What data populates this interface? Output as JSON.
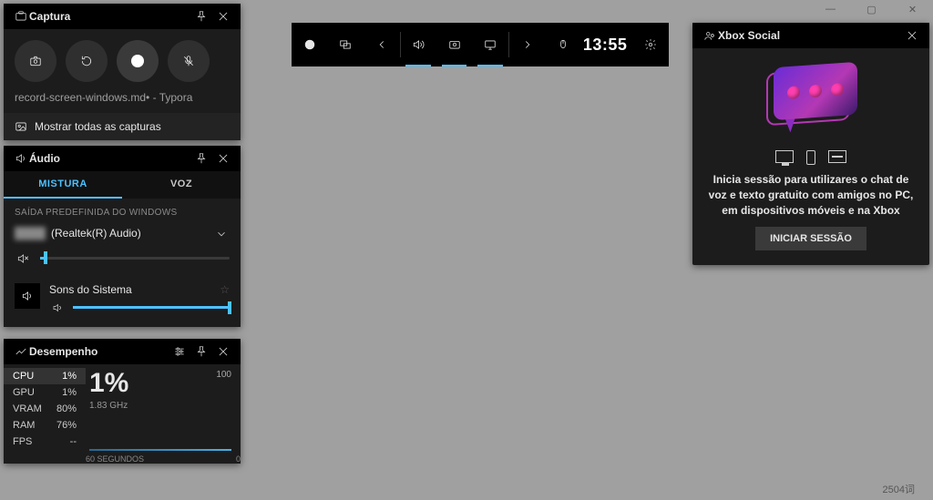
{
  "window_controls": {
    "minimize": "—",
    "maximize": "▢",
    "close": "✕"
  },
  "bottom_counter": "2504词",
  "toolbar": {
    "time": "13:55"
  },
  "capture": {
    "title": "Captura",
    "subtitle": "record-screen-windows.md• - Typora",
    "link": "Mostrar todas as capturas"
  },
  "audio": {
    "title": "Áudio",
    "tabs": {
      "mix": "MISTURA",
      "voice": "VOZ"
    },
    "output_label": "SAÍDA PREDEFINIDA DO WINDOWS",
    "device": "(Realtek(R) Audio)",
    "system_sounds": "Sons do Sistema"
  },
  "perf": {
    "title": "Desempenho",
    "metrics": [
      {
        "name": "CPU",
        "value": "1%"
      },
      {
        "name": "GPU",
        "value": "1%"
      },
      {
        "name": "VRAM",
        "value": "80%"
      },
      {
        "name": "RAM",
        "value": "76%"
      },
      {
        "name": "FPS",
        "value": "--"
      }
    ],
    "big": "1%",
    "big_sub": "1.83 GHz",
    "chart_max": "100",
    "chart_min": "0",
    "chart_xlabel": "60 SEGUNDOS"
  },
  "social": {
    "title": "Xbox Social",
    "text": "Inicia sessão para utilizares o chat de voz e texto gratuito com amigos no PC, em dispositivos móveis e na Xbox",
    "button": "INICIAR SESSÃO"
  }
}
